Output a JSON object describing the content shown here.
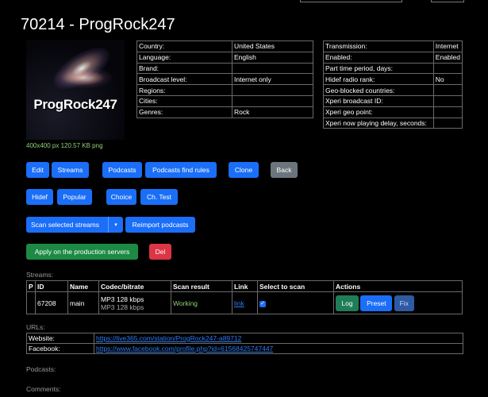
{
  "header": {
    "title": "70214 - ProgRock247"
  },
  "logo": {
    "text": "ProgRock247",
    "info": "400x400 px 120.57 KB png"
  },
  "info_left": [
    {
      "label": "Country:",
      "value": "United States"
    },
    {
      "label": "Language:",
      "value": "English"
    },
    {
      "label": "Brand:",
      "value": ""
    },
    {
      "label": "Broadcast level:",
      "value": "Internet only"
    },
    {
      "label": "Regions:",
      "value": ""
    },
    {
      "label": "Cities:",
      "value": ""
    },
    {
      "label": "Genres:",
      "value": "Rock"
    }
  ],
  "info_right": [
    {
      "label": "Transmission:",
      "value": "Internet"
    },
    {
      "label": "Enabled:",
      "value": "Enabled"
    },
    {
      "label": "Part time period, days:",
      "value": ""
    },
    {
      "label": "Hidef radio rank:",
      "value": "No"
    },
    {
      "label": "Geo-blocked countries:",
      "value": ""
    },
    {
      "label": "Xperi broadcast ID:",
      "value": ""
    },
    {
      "label": "Xperi geo point:",
      "value": ""
    },
    {
      "label": "Xperi now playing delay, seconds:",
      "value": ""
    }
  ],
  "buttons": {
    "edit": "Edit",
    "streams": "Streams",
    "podcasts": "Podcasts",
    "podcasts_find_rules": "Podcasts find rules",
    "clone": "Clone",
    "back": "Back",
    "hidef": "Hidef",
    "popular": "Popular",
    "choice": "Choice",
    "ch_test": "Ch. Test",
    "scan_selected_streams": "Scan selected streams",
    "reimport_podcasts": "Reimport podcasts",
    "apply_production": "Apply on the production servers",
    "del": "Del"
  },
  "streams_section": {
    "label": "Streams:",
    "headers": [
      "P",
      "ID",
      "Name",
      "Codec/bitrate",
      "Scan result",
      "Link",
      "Select to scan",
      "Actions"
    ],
    "rows": [
      {
        "p": "",
        "id": "67208",
        "name": "main",
        "codec_primary": "MP3 128 kbps",
        "codec_secondary": "MP3 128 kbps",
        "scan_result": "Working",
        "link": "link",
        "selected": true,
        "actions": {
          "log": "Log",
          "preset": "Preset",
          "fix": "Fix"
        }
      }
    ]
  },
  "urls_section": {
    "label": "URLs:",
    "rows": [
      {
        "label": "Website:",
        "url": "https://live365.com/station/ProgRock247-a89712"
      },
      {
        "label": "Facebook:",
        "url": "https://www.facebook.com/profile.php?id=61568425747447"
      }
    ]
  },
  "podcasts_section": {
    "label": "Podcasts:"
  },
  "comments_section": {
    "label": "Comments:"
  },
  "colors": {
    "primary": "#1a6ef7",
    "secondary": "#6c757d",
    "success": "#1c8a44",
    "danger": "#dc3545",
    "working": "#8fd17a",
    "link": "#2d7bf5"
  }
}
